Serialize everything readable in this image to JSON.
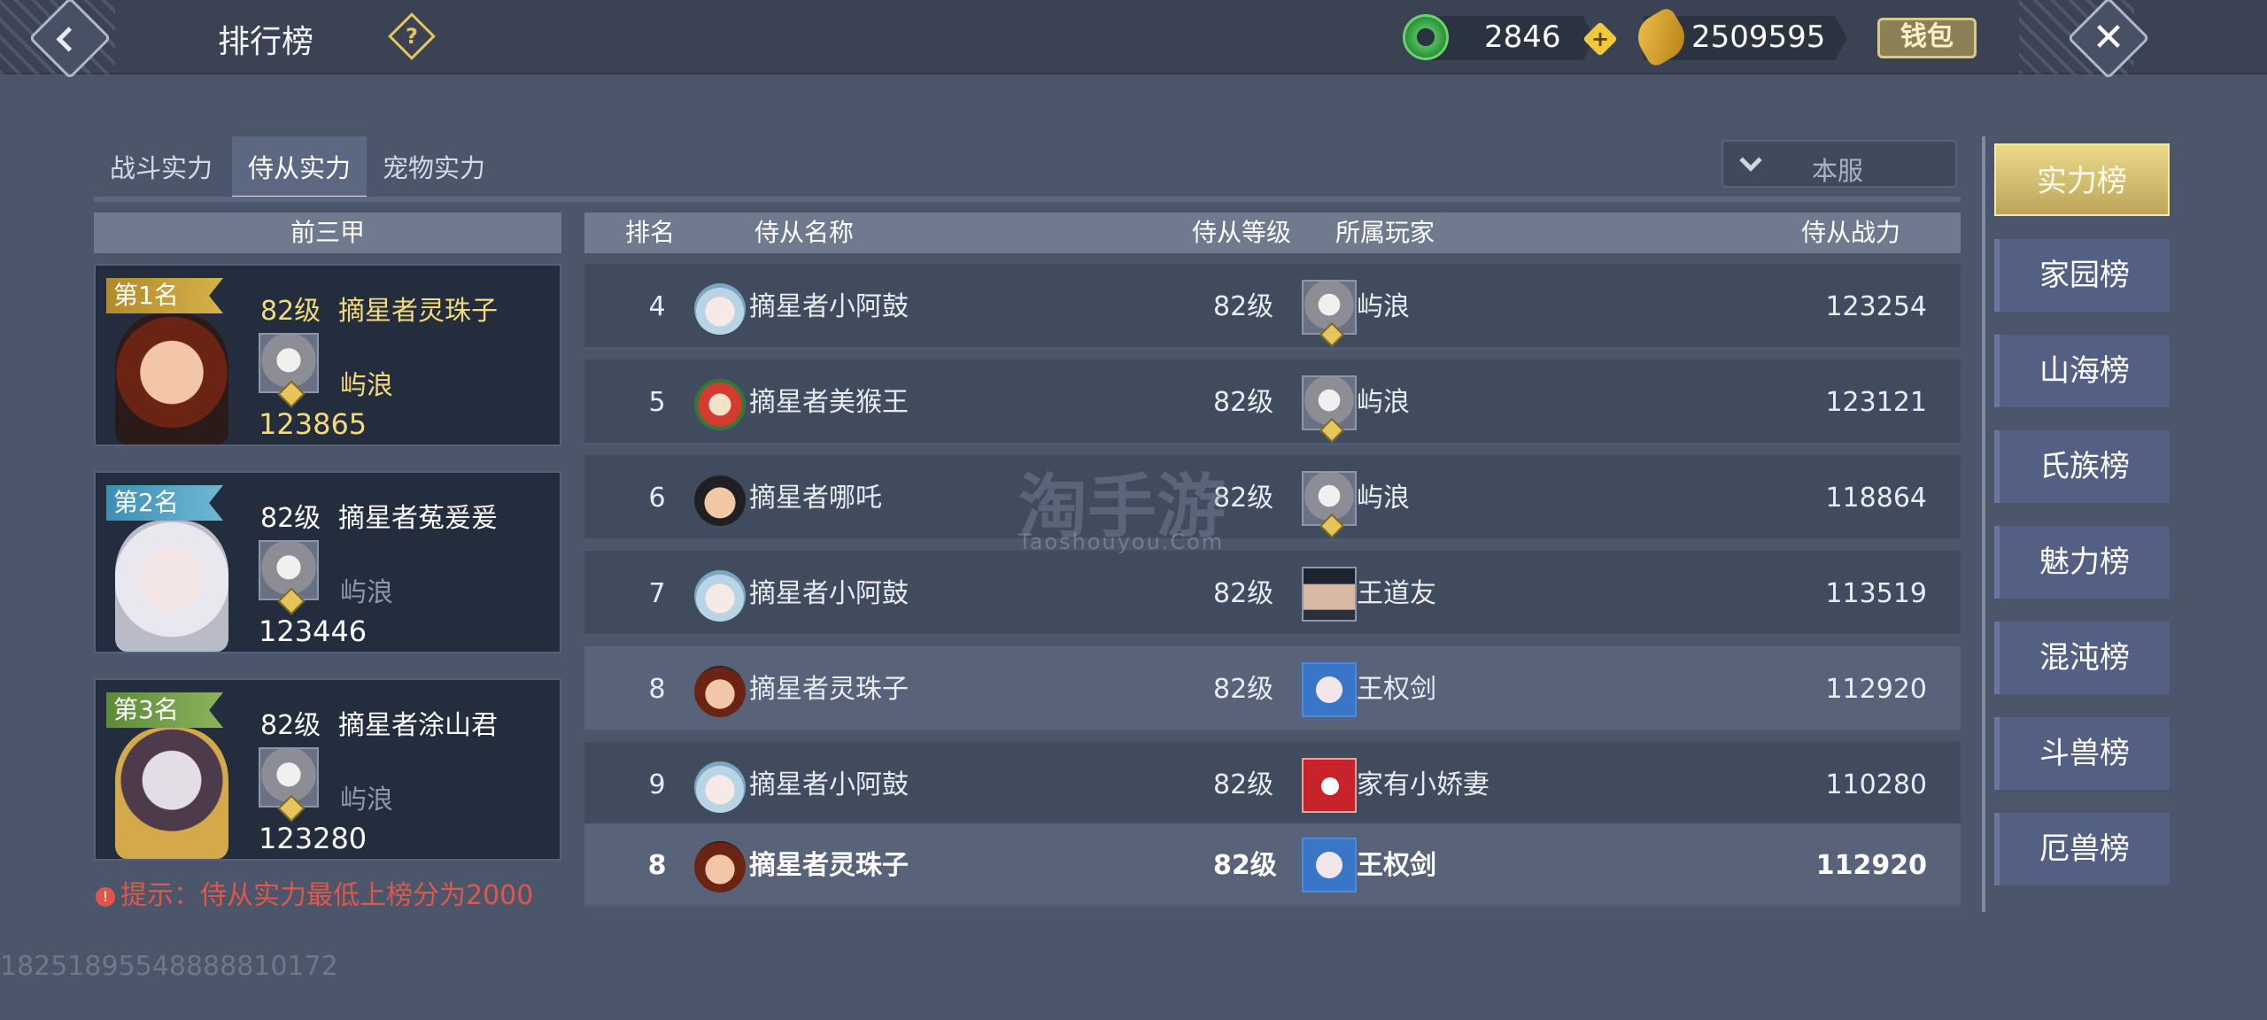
{
  "header": {
    "title": "排行榜",
    "help_icon": "?",
    "jade_value": "2846",
    "gold_value": "2509595",
    "wallet_label": "钱包",
    "close_icon": "✕"
  },
  "tabs": [
    "战斗实力",
    "侍从实力",
    "宠物实力"
  ],
  "active_tab": 1,
  "server_filter": "本服",
  "top3": {
    "header": "前三甲",
    "cards": [
      {
        "rank_label": "第1名",
        "level": "82级",
        "name": "摘星者灵珠子",
        "player": "屿浪",
        "power": "123865"
      },
      {
        "rank_label": "第2名",
        "level": "82级",
        "name": "摘星者菟爰爰",
        "player": "屿浪",
        "power": "123446"
      },
      {
        "rank_label": "第3名",
        "level": "82级",
        "name": "摘星者涂山君",
        "player": "屿浪",
        "power": "123280"
      }
    ]
  },
  "tip": "提示：侍从实力最低上榜分为2000",
  "footer_id": "18251895548888810172",
  "table": {
    "headers": {
      "rank": "排名",
      "name": "侍从名称",
      "level": "侍从等级",
      "player": "所属玩家",
      "power": "侍从战力"
    },
    "rows": [
      {
        "rank": "4",
        "name": "摘星者小阿鼓",
        "level": "82级",
        "player": "屿浪",
        "power": "123254"
      },
      {
        "rank": "5",
        "name": "摘星者美猴王",
        "level": "82级",
        "player": "屿浪",
        "power": "123121"
      },
      {
        "rank": "6",
        "name": "摘星者哪吒",
        "level": "82级",
        "player": "屿浪",
        "power": "118864"
      },
      {
        "rank": "7",
        "name": "摘星者小阿鼓",
        "level": "82级",
        "player": "王道友",
        "power": "113519"
      },
      {
        "rank": "8",
        "name": "摘星者灵珠子",
        "level": "82级",
        "player": "王权剑",
        "power": "112920"
      },
      {
        "rank": "9",
        "name": "摘星者小阿鼓",
        "level": "82级",
        "player": "家有小娇妻",
        "power": "110280"
      }
    ],
    "my_row": {
      "rank": "8",
      "name": "摘星者灵珠子",
      "level": "82级",
      "player": "王权剑",
      "power": "112920"
    }
  },
  "watermark": {
    "main": "淘手游",
    "sub": "Taoshouyou.Com"
  },
  "categories": [
    "实力榜",
    "家园榜",
    "山海榜",
    "氏族榜",
    "魅力榜",
    "混沌榜",
    "斗兽榜",
    "厄兽榜"
  ],
  "active_category": 0
}
